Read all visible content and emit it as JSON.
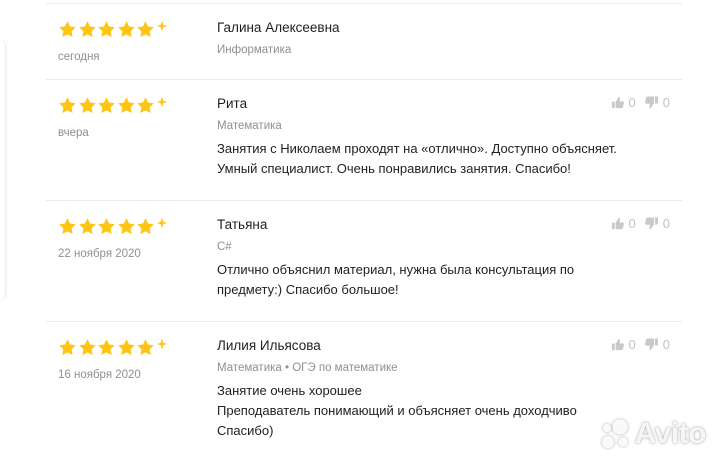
{
  "reviews": [
    {
      "rating": 5,
      "author": "Галина Алексеевна",
      "date": "сегодня",
      "subject": "Информатика",
      "text_lines": [],
      "votes": null
    },
    {
      "rating": 5,
      "author": "Рита",
      "date": "вчера",
      "subject": "Математика",
      "text_lines": [
        "Занятия с Николаем проходят на «отлично». Доступно объясняет.",
        "Умный специалист. Очень понравились занятия. Спасибо!"
      ],
      "votes": {
        "up": "0",
        "down": "0"
      }
    },
    {
      "rating": 5,
      "author": "Татьяна",
      "date": "22 ноября 2020",
      "subject": "C#",
      "text_lines": [
        "Отлично объяснил материал, нужна была консультация по",
        "предмету:) Спасибо большое!"
      ],
      "votes": {
        "up": "0",
        "down": "0"
      }
    },
    {
      "rating": 5,
      "author": "Лилия Ильясова",
      "date": "16 ноября 2020",
      "subject": "Математика • ОГЭ по математике",
      "text_lines": [
        "Занятие очень хорошее",
        "Преподаватель понимающий и объясняет очень доходчиво",
        "Спасибо)"
      ],
      "votes": {
        "up": "0",
        "down": "0"
      }
    }
  ],
  "icons": {
    "star": "star-icon",
    "sparkle": "sparkle-icon",
    "thumb_up": "thumbs-up-icon",
    "thumb_down": "thumbs-down-icon",
    "watermark_logo": "avito-logo-icon"
  },
  "colors": {
    "star": "#ffc515",
    "muted_text": "#8f8f8f",
    "vote_icon": "#c9c9c9",
    "divider": "#ececec"
  },
  "watermark": {
    "text": "Avito"
  }
}
